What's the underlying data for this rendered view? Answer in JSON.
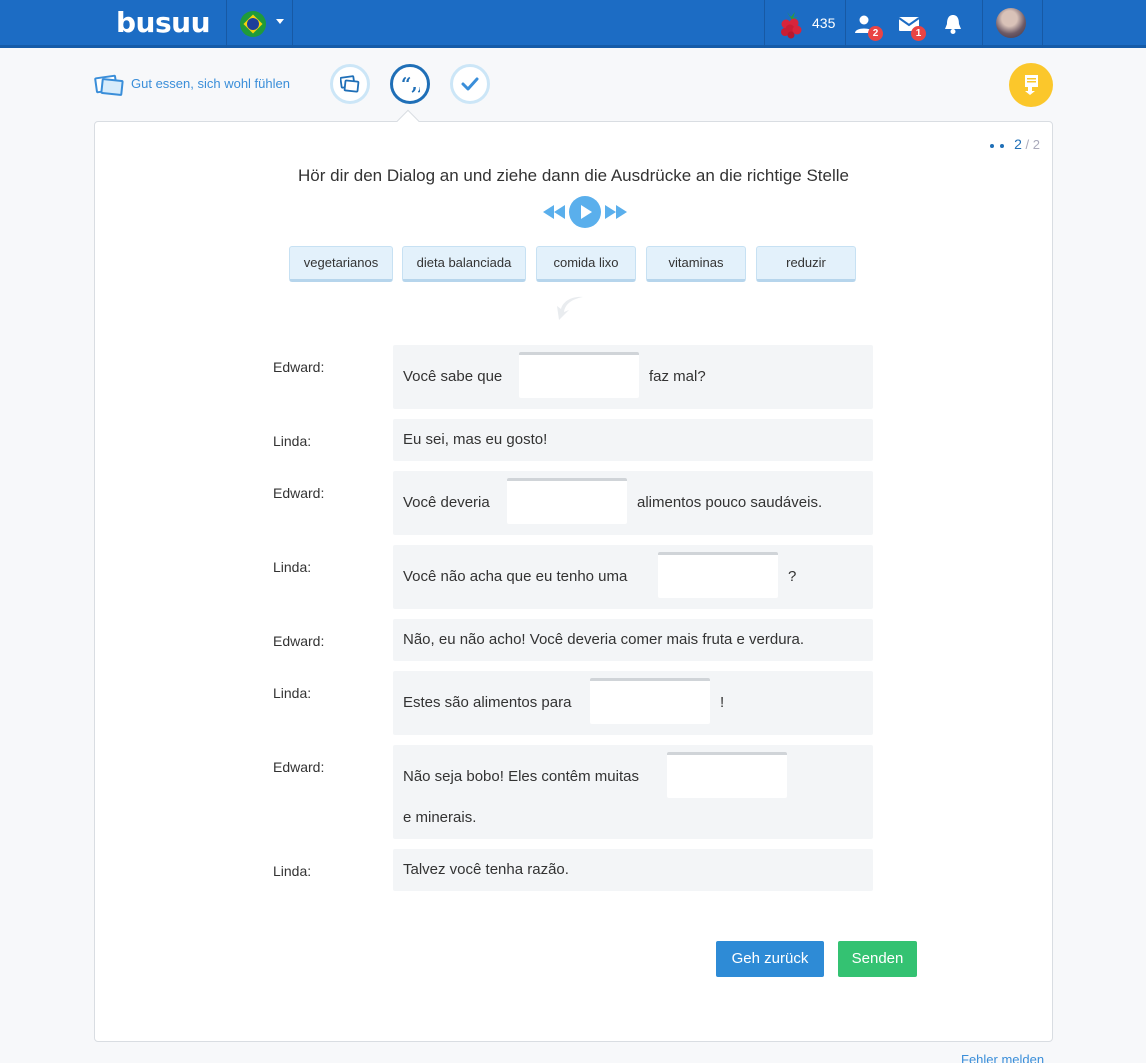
{
  "header": {
    "logo": "busuu",
    "language_flag": "brazil-flag-icon",
    "points": "435",
    "friends_badge": "2",
    "messages_badge": "1",
    "colors": {
      "bar": "#1c6cc4",
      "badge": "#e94444"
    }
  },
  "lesson": {
    "title": "Gut essen, sich wohl fühlen",
    "steps": [
      "vocabulary-icon",
      "dialog-quote-icon",
      "check-icon"
    ],
    "active_step": 1
  },
  "exercise": {
    "progress_current": "2",
    "progress_total": "/ 2",
    "instruction": "Hör dir den Dialog an und ziehe dann die Ausdrücke an die richtige Stelle",
    "chips": [
      "vegetarianos",
      "dieta balanciada",
      "comida lixo",
      "vitaminas",
      "reduzir"
    ],
    "dialog": [
      {
        "speaker": "Edward:",
        "before": "Você sabe que",
        "after": "faz mal?"
      },
      {
        "speaker": "Linda:",
        "text": "Eu sei, mas eu gosto!"
      },
      {
        "speaker": "Edward:",
        "before": "Você deveria",
        "after": "alimentos pouco saudáveis."
      },
      {
        "speaker": "Linda:",
        "before": "Você não acha que eu tenho uma",
        "after": "?"
      },
      {
        "speaker": "Edward:",
        "text": "Não, eu não acho! Você deveria comer mais fruta e verdura."
      },
      {
        "speaker": "Linda:",
        "before": "Estes são alimentos para",
        "after": "!"
      },
      {
        "speaker": "Edward:",
        "before": "Não seja bobo! Eles contêm muitas",
        "after": "e minerais."
      },
      {
        "speaker": "Linda:",
        "text": "Talvez você tenha razão."
      }
    ],
    "back_label": "Geh zurück",
    "send_label": "Senden"
  },
  "footer": {
    "report_label": "Fehler melden"
  }
}
